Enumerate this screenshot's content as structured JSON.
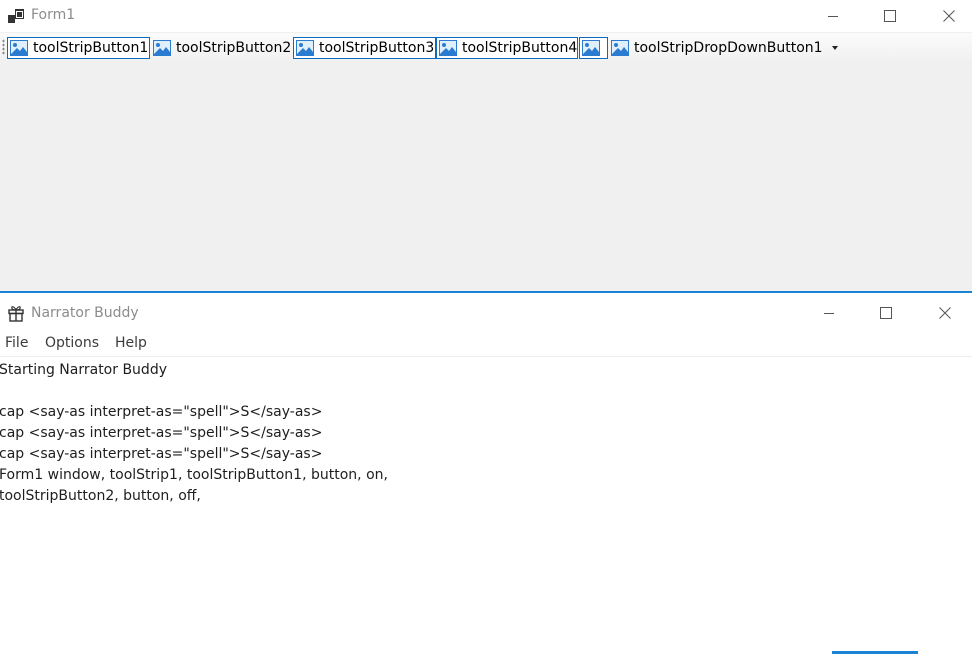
{
  "form1": {
    "title": "Form1",
    "toolstrip": {
      "buttons": [
        {
          "label": "toolStripButton1",
          "checked": true
        },
        {
          "label": "toolStripButton2",
          "checked": false
        },
        {
          "label": "toolStripButton3",
          "checked": true
        },
        {
          "label": "toolStripButton4",
          "checked": true
        },
        {
          "label": "",
          "checked": true
        },
        {
          "label": "toolStripDropDownButton1",
          "checked": false
        }
      ]
    }
  },
  "narrator": {
    "title": "Narrator Buddy",
    "menu": [
      "File",
      "Options",
      "Help"
    ],
    "log": [
      "Starting Narrator Buddy",
      "",
      "cap <say-as interpret-as=\"spell\">S</say-as>",
      "cap <say-as interpret-as=\"spell\">S</say-as>",
      "cap <say-as interpret-as=\"spell\">S</say-as>",
      "Form1 window, toolStrip1, toolStripButton1, button, on,",
      "toolStripButton2, button, off,"
    ]
  },
  "icons": {
    "form1_app": "window-app-icon",
    "narrator_app": "gift-icon",
    "toolstrip_image": "image-placeholder-icon",
    "minimize": "minimize-icon",
    "maximize": "maximize-icon",
    "close": "close-icon",
    "dropdown": "chevron-down-icon"
  },
  "colors": {
    "accent": "#1b83d3",
    "checked_border": "#0a6bc1",
    "client_bg": "#f0f0f0",
    "title_inactive": "#8c8c8c"
  }
}
